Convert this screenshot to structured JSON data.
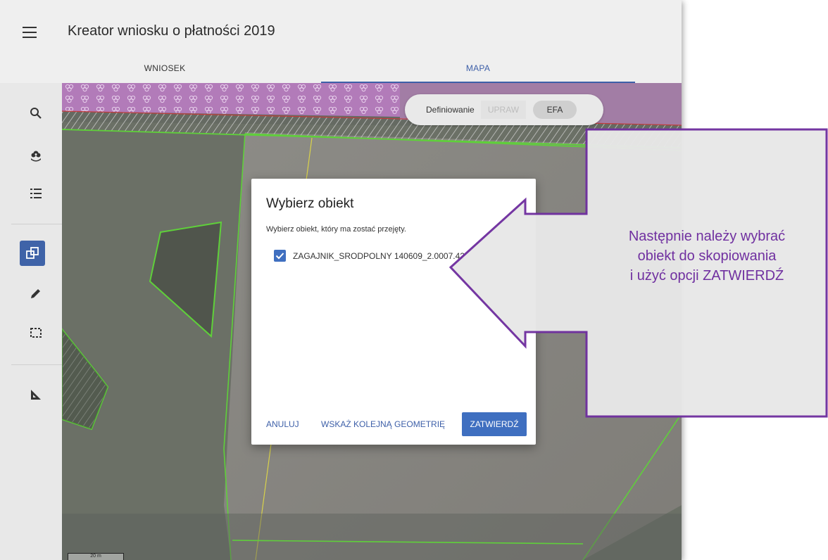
{
  "header": {
    "title": "Kreator wniosku o płatności 2019",
    "menu_icon": "hamburger-menu-icon"
  },
  "tabs": [
    {
      "label": "WNIOSEK",
      "active": false
    },
    {
      "label": "MAPA",
      "active": true
    }
  ],
  "toolbar": {
    "tools": [
      "search-icon",
      "layers-flower-icon",
      "list-icon",
      "copy-geometry-icon",
      "pencil-icon",
      "select-rectangle-icon",
      "measure-icon"
    ],
    "active_tool": "copy-geometry-icon"
  },
  "mode_toggle": {
    "label": "Definiowanie",
    "option_uprawy": "UPRAW",
    "option_efa": "EFA"
  },
  "dialog": {
    "title": "Wybierz obiekt",
    "subtitle": "Wybierz obiekt, który ma zostać przejęty.",
    "option_label": "ZAGAJNIK_SRODPOLNY 140609_2.0007.42",
    "option_checked": true,
    "cancel_label": "ANULUJ",
    "next_label": "WSKAŻ KOLEJNĄ GEOMETRIĘ",
    "confirm_label": "ZATWIERDŹ"
  },
  "callout": {
    "line1": "Następnie należy wybrać",
    "line2": "obiekt do skopiowania",
    "line3": "i użyć opcji ZATWIERDŹ",
    "color": "#7030a0"
  },
  "colors": {
    "accent": "#3f6fc0",
    "parcel_outline": "#5fd03a",
    "callout_border": "#7030a0"
  },
  "map": {
    "scale_label": "20 m"
  }
}
